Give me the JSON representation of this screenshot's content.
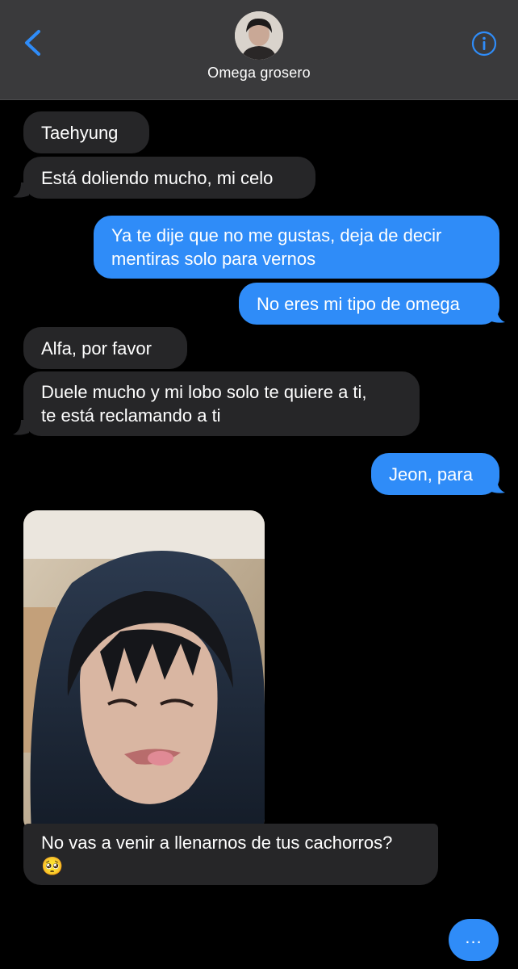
{
  "header": {
    "contact_name": "Omega grosero",
    "back_icon": "chevron-left-icon",
    "info_icon": "info-icon",
    "accent": "#2f8cf8"
  },
  "messages": [
    {
      "dir": "in",
      "text": "Taehyung"
    },
    {
      "dir": "in",
      "text": "Está doliendo mucho, mi celo"
    },
    {
      "dir": "out",
      "text": "Ya te dije que no me gustas, deja de decir\nmentiras solo para vernos"
    },
    {
      "dir": "out",
      "text": "No eres mi tipo de omega"
    },
    {
      "dir": "in",
      "text": "Alfa, por favor"
    },
    {
      "dir": "in",
      "text": "Duele mucho y mi lobo solo te quiere a ti,\nte está reclamando a ti"
    },
    {
      "dir": "out",
      "text": "Jeon, para"
    },
    {
      "dir": "in",
      "type": "photo",
      "text": ""
    },
    {
      "dir": "in",
      "text": "No vas a venir a llenarnos de tus cachorros?\n🥺"
    }
  ],
  "typing_indicator": "...",
  "colors": {
    "incoming": "#262628",
    "outgoing": "#2f8cf8",
    "header": "#3a3a3c"
  }
}
